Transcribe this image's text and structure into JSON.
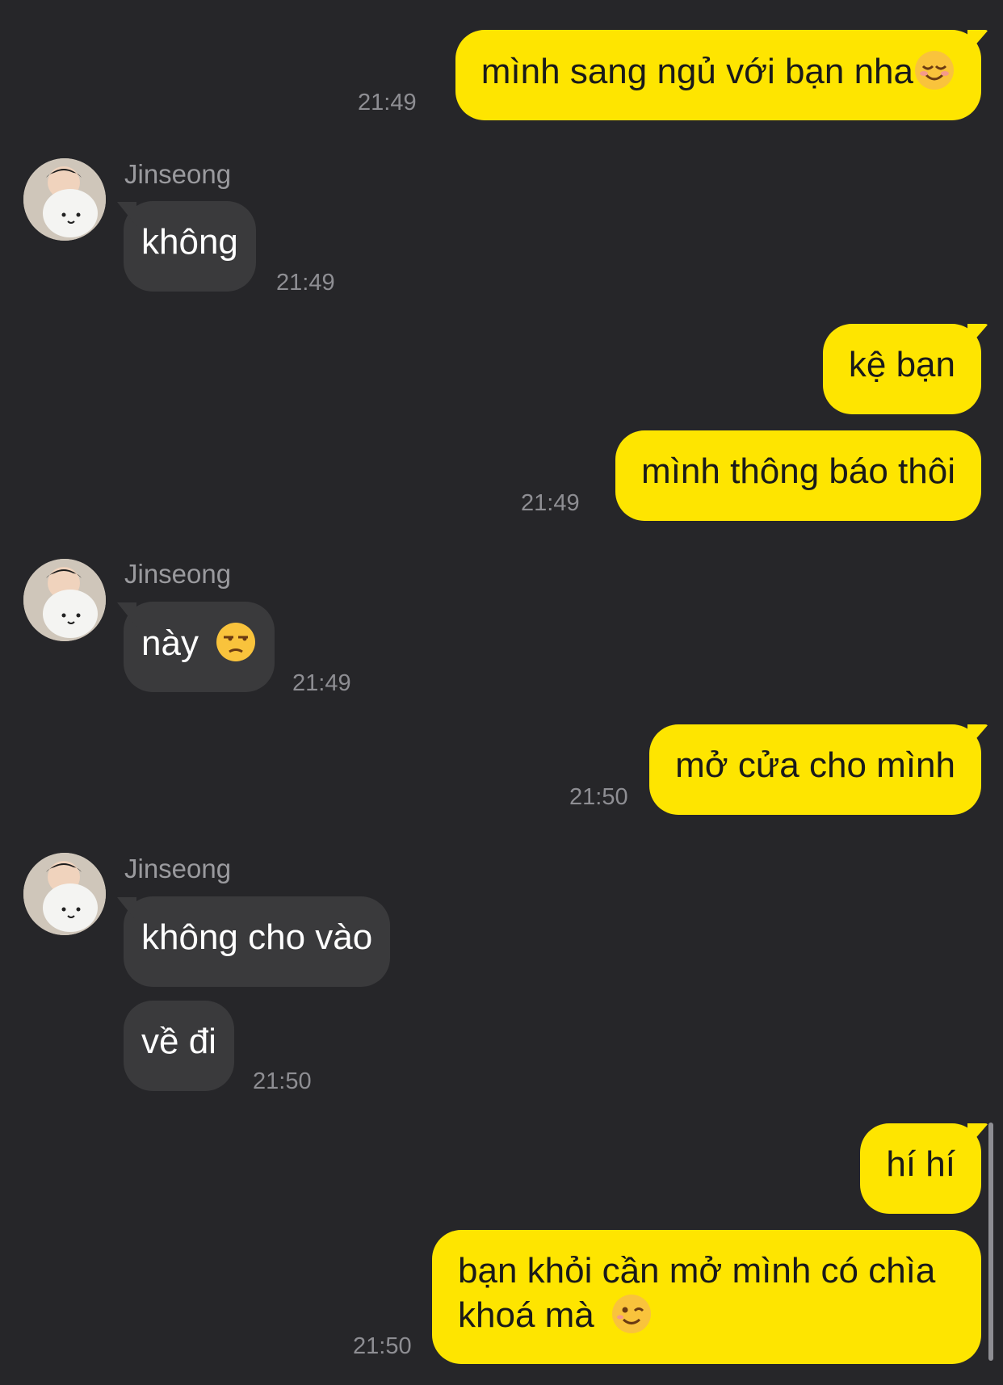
{
  "contact": {
    "name": "Jinseong"
  },
  "messages": [
    {
      "side": "out",
      "text": "mình sang ngủ với bạn nha",
      "emoji": "smiling-face-icon",
      "time": "21:49"
    },
    {
      "side": "in",
      "text": "không",
      "time": "21:49"
    },
    {
      "side": "out",
      "text": "kệ bạn"
    },
    {
      "side": "out",
      "text": "mình thông báo thôi",
      "time": "21:49"
    },
    {
      "side": "in",
      "text": "này",
      "emoji": "unamused-face-icon",
      "time": "21:49"
    },
    {
      "side": "out",
      "text": "mở cửa cho mình",
      "time": "21:50"
    },
    {
      "side": "in",
      "text": "không cho vào"
    },
    {
      "side": "in",
      "text": "về đi",
      "time": "21:50"
    },
    {
      "side": "out",
      "text": "hí hí"
    },
    {
      "side": "out",
      "text_line1": "bạn khỏi cần mở mình có chìa",
      "text_line2": "khoá mà",
      "emoji": "winking-face-icon",
      "time": "21:50"
    }
  ],
  "colors": {
    "background": "#262629",
    "outgoing_bubble": "#FEE500",
    "incoming_bubble": "#3A3A3C",
    "timestamp": "#8E8E93"
  }
}
